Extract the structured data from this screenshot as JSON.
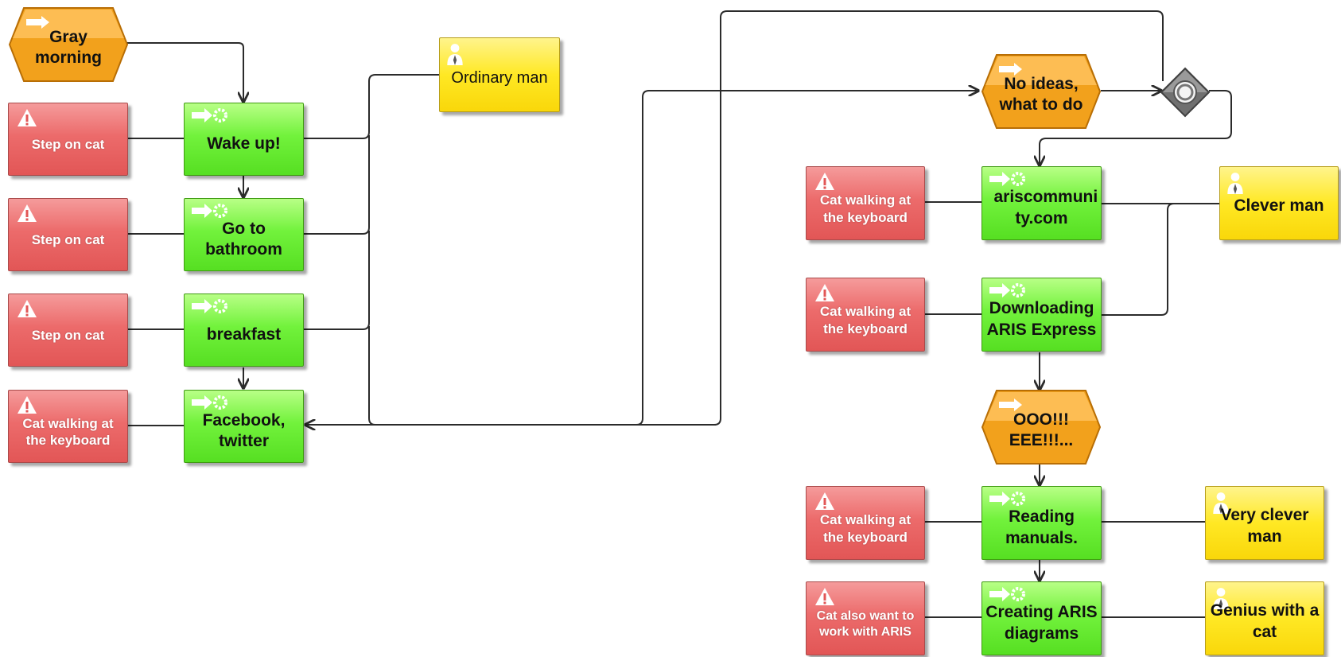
{
  "colors": {
    "risk": "#e86464",
    "function": "#66e82e",
    "role": "#ffe11a",
    "event": "#f7a531",
    "connector": "#2b2b2b",
    "gateway": "#6b6b6b"
  },
  "icons": {
    "risk": "warning-triangle-icon",
    "function": "function-gear-arrow-icon",
    "role": "person-icon",
    "event": "event-arrow-icon",
    "gateway": "xor-circle-icon"
  },
  "nodes": {
    "gray_morning": "Gray morning",
    "ordinary_man": "Ordinary man",
    "wake_up": "Wake up!",
    "go_bathroom": "Go to bathroom",
    "breakfast": "breakfast",
    "facebook": "Facebook, twitter",
    "risk_step_1": "Step on cat",
    "risk_step_2": "Step on cat",
    "risk_step_3": "Step on cat",
    "risk_cat_1": "Cat walking at the keyboard",
    "no_ideas": "No ideas, what to do",
    "ariscommunity": "ariscommuni ty.com",
    "clever_man": "Clever man",
    "risk_cat_2": "Cat walking at the keyboard",
    "downloading": "Downloading ARIS Express",
    "risk_cat_3": "Cat walking at the keyboard",
    "ooo_eee": "OOO!!! EEE!!!...",
    "risk_cat_4": "Cat walking at the keyboard",
    "reading": "Reading manuals.",
    "very_clever_man": "Very clever man",
    "risk_cat_5": "Cat also want to work with ARIS",
    "creating": "Creating ARIS diagrams",
    "genius": "Genius with a cat"
  }
}
